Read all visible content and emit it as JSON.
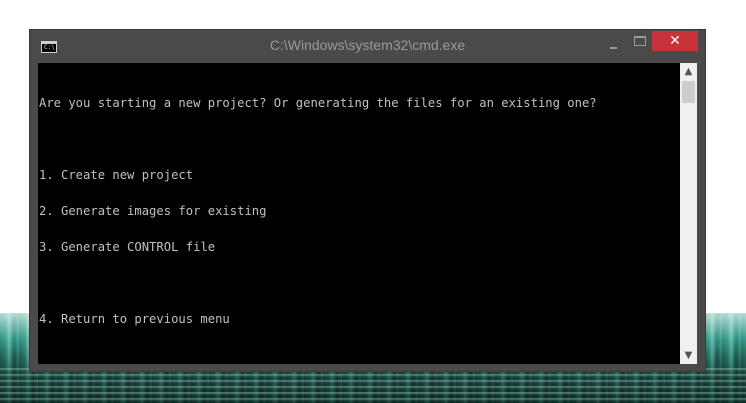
{
  "window": {
    "title": "C:\\Windows\\system32\\cmd.exe",
    "icon": "console-app-icon",
    "icon_text": "C:\\",
    "close_label": "✕",
    "controls": [
      "minimize-icon",
      "maximize-icon",
      "close-icon"
    ]
  },
  "console": {
    "lines": [
      "Are you starting a new project? Or generating the files for an existing one?",
      "",
      "1. Create new project",
      "2. Generate images for existing",
      "3. Generate CONTROL file",
      "",
      "4. Return to previous menu"
    ]
  },
  "scrollbar": {
    "up_arrow": "▲",
    "down_arrow": "▼"
  },
  "colors": {
    "console_bg": "#000000",
    "console_fg": "#c0c0c0",
    "frame": "#4a4a4a",
    "close_button": "#c8333a"
  }
}
